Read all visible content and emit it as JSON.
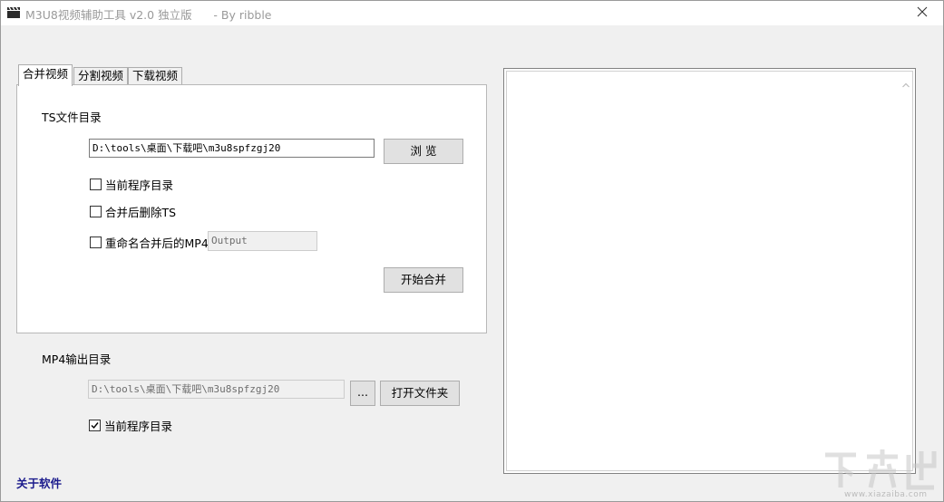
{
  "window": {
    "title": "M3U8视频辅助工具 v2.0 独立版      - By ribble"
  },
  "tabs": [
    {
      "label": "合并视频",
      "active": true
    },
    {
      "label": "分割视频",
      "active": false
    },
    {
      "label": "下载视频",
      "active": false
    }
  ],
  "merge": {
    "ts_dir_label": "TS文件目录",
    "ts_dir_value": "D:\\tools\\桌面\\下载吧\\m3u8spfzgj20",
    "browse_button": "浏 览",
    "current_dir_checkbox": {
      "label": "当前程序目录",
      "checked": false
    },
    "delete_ts_checkbox": {
      "label": "合并后删除TS",
      "checked": false
    },
    "rename_checkbox": {
      "label": "重命名合并后的MP4",
      "checked": false
    },
    "rename_placeholder": "Output",
    "start_button": "开始合并"
  },
  "output": {
    "mp4_dir_label": "MP4输出目录",
    "mp4_dir_value": "D:\\tools\\桌面\\下载吧\\m3u8spfzgj20",
    "ellipsis_button": "...",
    "open_folder_button": "打开文件夹",
    "current_dir_checkbox": {
      "label": "当前程序目录",
      "checked": true
    }
  },
  "about_link": "关于软件",
  "watermark": {
    "logo_text": "下载吧",
    "url": "www.xiazaiba.com"
  },
  "colors": {
    "accent_link": "#1a1a8c",
    "annotation_arrow": "#c0282d"
  },
  "icons": {
    "app": "clapperboard-icon",
    "close": "close-icon",
    "scroll_up": "chevron-up-icon"
  }
}
